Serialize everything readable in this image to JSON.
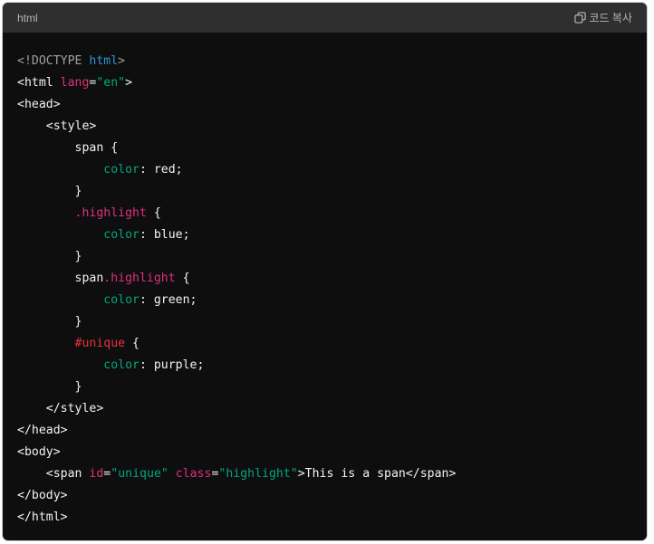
{
  "header": {
    "language": "html",
    "copy_label": "코드 복사"
  },
  "lines": [
    [
      {
        "t": "<!DOCTYPE ",
        "c": "doctype"
      },
      {
        "t": "html",
        "c": "kw"
      },
      {
        "t": ">",
        "c": "doctype"
      }
    ],
    [
      {
        "t": "<html ",
        "c": "tag"
      },
      {
        "t": "lang",
        "c": "attr"
      },
      {
        "t": "=",
        "c": "punct"
      },
      {
        "t": "\"en\"",
        "c": "str"
      },
      {
        "t": ">",
        "c": "tag"
      }
    ],
    [
      {
        "t": "<head>",
        "c": "tag"
      }
    ],
    [
      {
        "t": "    <style>",
        "c": "tag"
      }
    ],
    [
      {
        "t": "        span {",
        "c": "text"
      }
    ],
    [
      {
        "t": "            ",
        "c": "text"
      },
      {
        "t": "color",
        "c": "prop"
      },
      {
        "t": ": red;",
        "c": "text"
      }
    ],
    [
      {
        "t": "        }",
        "c": "text"
      }
    ],
    [
      {
        "t": "        ",
        "c": "text"
      },
      {
        "t": ".highlight",
        "c": "sel"
      },
      {
        "t": " {",
        "c": "text"
      }
    ],
    [
      {
        "t": "            ",
        "c": "text"
      },
      {
        "t": "color",
        "c": "prop"
      },
      {
        "t": ": blue;",
        "c": "text"
      }
    ],
    [
      {
        "t": "        }",
        "c": "text"
      }
    ],
    [
      {
        "t": "        span",
        "c": "text"
      },
      {
        "t": ".highlight",
        "c": "sel"
      },
      {
        "t": " {",
        "c": "text"
      }
    ],
    [
      {
        "t": "            ",
        "c": "text"
      },
      {
        "t": "color",
        "c": "prop"
      },
      {
        "t": ": green;",
        "c": "text"
      }
    ],
    [
      {
        "t": "        }",
        "c": "text"
      }
    ],
    [
      {
        "t": "        ",
        "c": "text"
      },
      {
        "t": "#unique",
        "c": "id"
      },
      {
        "t": " {",
        "c": "text"
      }
    ],
    [
      {
        "t": "            ",
        "c": "text"
      },
      {
        "t": "color",
        "c": "prop"
      },
      {
        "t": ": purple;",
        "c": "text"
      }
    ],
    [
      {
        "t": "        }",
        "c": "text"
      }
    ],
    [
      {
        "t": "    </style>",
        "c": "tag"
      }
    ],
    [
      {
        "t": "</head>",
        "c": "tag"
      }
    ],
    [
      {
        "t": "<body>",
        "c": "tag"
      }
    ],
    [
      {
        "t": "    <span ",
        "c": "tag"
      },
      {
        "t": "id",
        "c": "attr"
      },
      {
        "t": "=",
        "c": "punct"
      },
      {
        "t": "\"unique\"",
        "c": "str"
      },
      {
        "t": " ",
        "c": "text"
      },
      {
        "t": "class",
        "c": "attr"
      },
      {
        "t": "=",
        "c": "punct"
      },
      {
        "t": "\"highlight\"",
        "c": "str"
      },
      {
        "t": ">This is a span</span>",
        "c": "tag"
      }
    ],
    [
      {
        "t": "</body>",
        "c": "tag"
      }
    ],
    [
      {
        "t": "</html>",
        "c": "tag"
      }
    ]
  ],
  "colors": {
    "background": "#0e0e0e",
    "header": "#2f2f2f",
    "keyword": "#2e95d3",
    "attribute": "#df3079",
    "string": "#00a67d",
    "id_selector": "#e9313a"
  }
}
